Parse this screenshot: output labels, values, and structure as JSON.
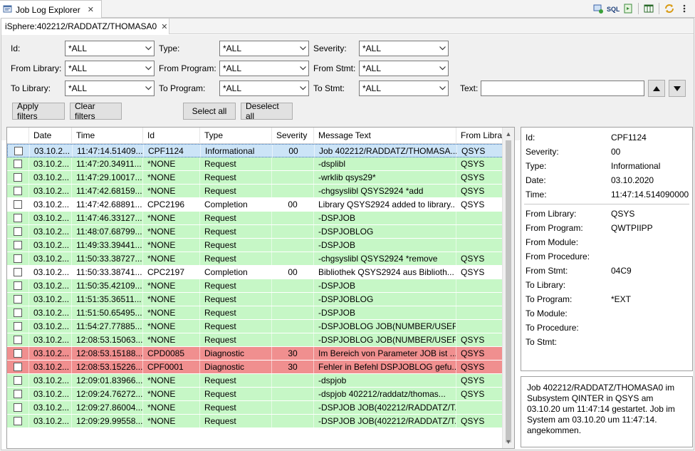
{
  "view": {
    "title": "Job Log Explorer",
    "tab_icon": "job-log-icon",
    "close": "✕",
    "tools": [
      "connect-icon",
      "sql-icon",
      "export-icon",
      "columns-icon",
      "refresh-icon",
      "view-menu-icon"
    ]
  },
  "editor_tab": {
    "label": "iSphere:402212/RADDATZ/THOMASA0",
    "close": "✕"
  },
  "filters": {
    "id": {
      "label": "Id:",
      "value": "*ALL"
    },
    "type": {
      "label": "Type:",
      "value": "*ALL"
    },
    "severity": {
      "label": "Severity:",
      "value": "*ALL"
    },
    "from_library": {
      "label": "From Library:",
      "value": "*ALL"
    },
    "from_program": {
      "label": "From Program:",
      "value": "*ALL"
    },
    "from_stmt": {
      "label": "From Stmt:",
      "value": "*ALL"
    },
    "to_library": {
      "label": "To Library:",
      "value": "*ALL"
    },
    "to_program": {
      "label": "To Program:",
      "value": "*ALL"
    },
    "to_stmt": {
      "label": "To Stmt:",
      "value": "*ALL"
    },
    "text": {
      "label": "Text:",
      "value": ""
    },
    "apply_label": "Apply filters",
    "clear_label": "Clear filters",
    "select_all_label": "Select all",
    "deselect_all_label": "Deselect all"
  },
  "table": {
    "columns": [
      "",
      "Date",
      "Time",
      "Id",
      "Type",
      "Severity",
      "Message Text",
      "From Libra"
    ],
    "rows": [
      {
        "date": "03.10.2...",
        "time": "11:47:14.51409...",
        "id": "CPF1124",
        "type": "Informational",
        "sev": "00",
        "msg": "Job 402212/RADDATZ/THOMASA...",
        "lib": "QSYS",
        "color": "sel"
      },
      {
        "date": "03.10.2...",
        "time": "11:47:20.34911...",
        "id": "*NONE",
        "type": "Request",
        "sev": "",
        "msg": "-dsplibl",
        "lib": "QSYS",
        "color": "green"
      },
      {
        "date": "03.10.2...",
        "time": "11:47:29.10017...",
        "id": "*NONE",
        "type": "Request",
        "sev": "",
        "msg": "-wrklib qsys29*",
        "lib": "QSYS",
        "color": "green"
      },
      {
        "date": "03.10.2...",
        "time": "11:47:42.68159...",
        "id": "*NONE",
        "type": "Request",
        "sev": "",
        "msg": "-chgsyslibl QSYS2924 *add",
        "lib": "QSYS",
        "color": "green"
      },
      {
        "date": "03.10.2...",
        "time": "11:47:42.68891...",
        "id": "CPC2196",
        "type": "Completion",
        "sev": "00",
        "msg": "Library QSYS2924 added to library...",
        "lib": "QSYS",
        "color": "white"
      },
      {
        "date": "03.10.2...",
        "time": "11:47:46.33127...",
        "id": "*NONE",
        "type": "Request",
        "sev": "",
        "msg": "-DSPJOB",
        "lib": "",
        "color": "green"
      },
      {
        "date": "03.10.2...",
        "time": "11:48:07.68799...",
        "id": "*NONE",
        "type": "Request",
        "sev": "",
        "msg": "-DSPJOBLOG",
        "lib": "",
        "color": "green"
      },
      {
        "date": "03.10.2...",
        "time": "11:49:33.39441...",
        "id": "*NONE",
        "type": "Request",
        "sev": "",
        "msg": "-DSPJOB",
        "lib": "",
        "color": "green"
      },
      {
        "date": "03.10.2...",
        "time": "11:50:33.38727...",
        "id": "*NONE",
        "type": "Request",
        "sev": "",
        "msg": "-chgsyslibl QSYS2924 *remove",
        "lib": "QSYS",
        "color": "green"
      },
      {
        "date": "03.10.2...",
        "time": "11:50:33.38741...",
        "id": "CPC2197",
        "type": "Completion",
        "sev": "00",
        "msg": "Bibliothek QSYS2924 aus Biblioth...",
        "lib": "QSYS",
        "color": "white"
      },
      {
        "date": "03.10.2...",
        "time": "11:50:35.42109...",
        "id": "*NONE",
        "type": "Request",
        "sev": "",
        "msg": "-DSPJOB",
        "lib": "",
        "color": "green"
      },
      {
        "date": "03.10.2...",
        "time": "11:51:35.36511...",
        "id": "*NONE",
        "type": "Request",
        "sev": "",
        "msg": "-DSPJOBLOG",
        "lib": "",
        "color": "green"
      },
      {
        "date": "03.10.2...",
        "time": "11:51:50.65495...",
        "id": "*NONE",
        "type": "Request",
        "sev": "",
        "msg": "-DSPJOB",
        "lib": "",
        "color": "green"
      },
      {
        "date": "03.10.2...",
        "time": "11:54:27.77885...",
        "id": "*NONE",
        "type": "Request",
        "sev": "",
        "msg": "-DSPJOBLOG JOB(NUMBER/USER...",
        "lib": "",
        "color": "green"
      },
      {
        "date": "03.10.2...",
        "time": "12:08:53.15063...",
        "id": "*NONE",
        "type": "Request",
        "sev": "",
        "msg": "-DSPJOBLOG JOB(NUMBER/USER...",
        "lib": "QSYS",
        "color": "green"
      },
      {
        "date": "03.10.2...",
        "time": "12:08:53.15188...",
        "id": "CPD0085",
        "type": "Diagnostic",
        "sev": "30",
        "msg": "Im Bereich von Parameter JOB ist ...",
        "lib": "QSYS",
        "color": "red"
      },
      {
        "date": "03.10.2...",
        "time": "12:08:53.15226...",
        "id": "CPF0001",
        "type": "Diagnostic",
        "sev": "30",
        "msg": "Fehler in Befehl DSPJOBLOG gefu...",
        "lib": "QSYS",
        "color": "red"
      },
      {
        "date": "03.10.2...",
        "time": "12:09:01.83966...",
        "id": "*NONE",
        "type": "Request",
        "sev": "",
        "msg": "-dspjob",
        "lib": "QSYS",
        "color": "green"
      },
      {
        "date": "03.10.2...",
        "time": "12:09:24.76272...",
        "id": "*NONE",
        "type": "Request",
        "sev": "",
        "msg": "-dspjob   402212/raddatz/thomas...",
        "lib": "QSYS",
        "color": "green"
      },
      {
        "date": "03.10.2...",
        "time": "12:09:27.86004...",
        "id": "*NONE",
        "type": "Request",
        "sev": "",
        "msg": "-DSPJOB JOB(402212/RADDATZ/T...",
        "lib": "",
        "color": "green"
      },
      {
        "date": "03.10.2...",
        "time": "12:09:29.99558...",
        "id": "*NONE",
        "type": "Request",
        "sev": "",
        "msg": "-DSPJOB JOB(402212/RADDATZ/T...",
        "lib": "QSYS",
        "color": "green"
      }
    ]
  },
  "details": {
    "id": {
      "label": "Id:",
      "value": "CPF1124"
    },
    "severity": {
      "label": "Severity:",
      "value": "00"
    },
    "type": {
      "label": "Type:",
      "value": "Informational"
    },
    "date": {
      "label": "Date:",
      "value": "03.10.2020"
    },
    "time": {
      "label": "Time:",
      "value": "11:47:14.514090000"
    },
    "from_library": {
      "label": "From Library:",
      "value": "QSYS"
    },
    "from_program": {
      "label": "From Program:",
      "value": "QWTPIIPP"
    },
    "from_module": {
      "label": "From Module:",
      "value": ""
    },
    "from_procedure": {
      "label": "From Procedure:",
      "value": ""
    },
    "from_stmt": {
      "label": "From Stmt:",
      "value": "04C9"
    },
    "to_library": {
      "label": "To Library:",
      "value": ""
    },
    "to_program": {
      "label": "To Program:",
      "value": "*EXT"
    },
    "to_module": {
      "label": "To Module:",
      "value": ""
    },
    "to_procedure": {
      "label": "To Procedure:",
      "value": ""
    },
    "to_stmt": {
      "label": "To Stmt:",
      "value": ""
    }
  },
  "message_text": "Job 402212/RADDATZ/THOMASA0 im Subsystem QINTER in QSYS am 03.10.20 um 11:47:14 gestartet. Job im System am 03.10.20 um 11:47:14. angekommen.",
  "colors": {
    "green": "#c6f7c6",
    "red": "#f08f8f",
    "selected": "#cce4f7"
  }
}
